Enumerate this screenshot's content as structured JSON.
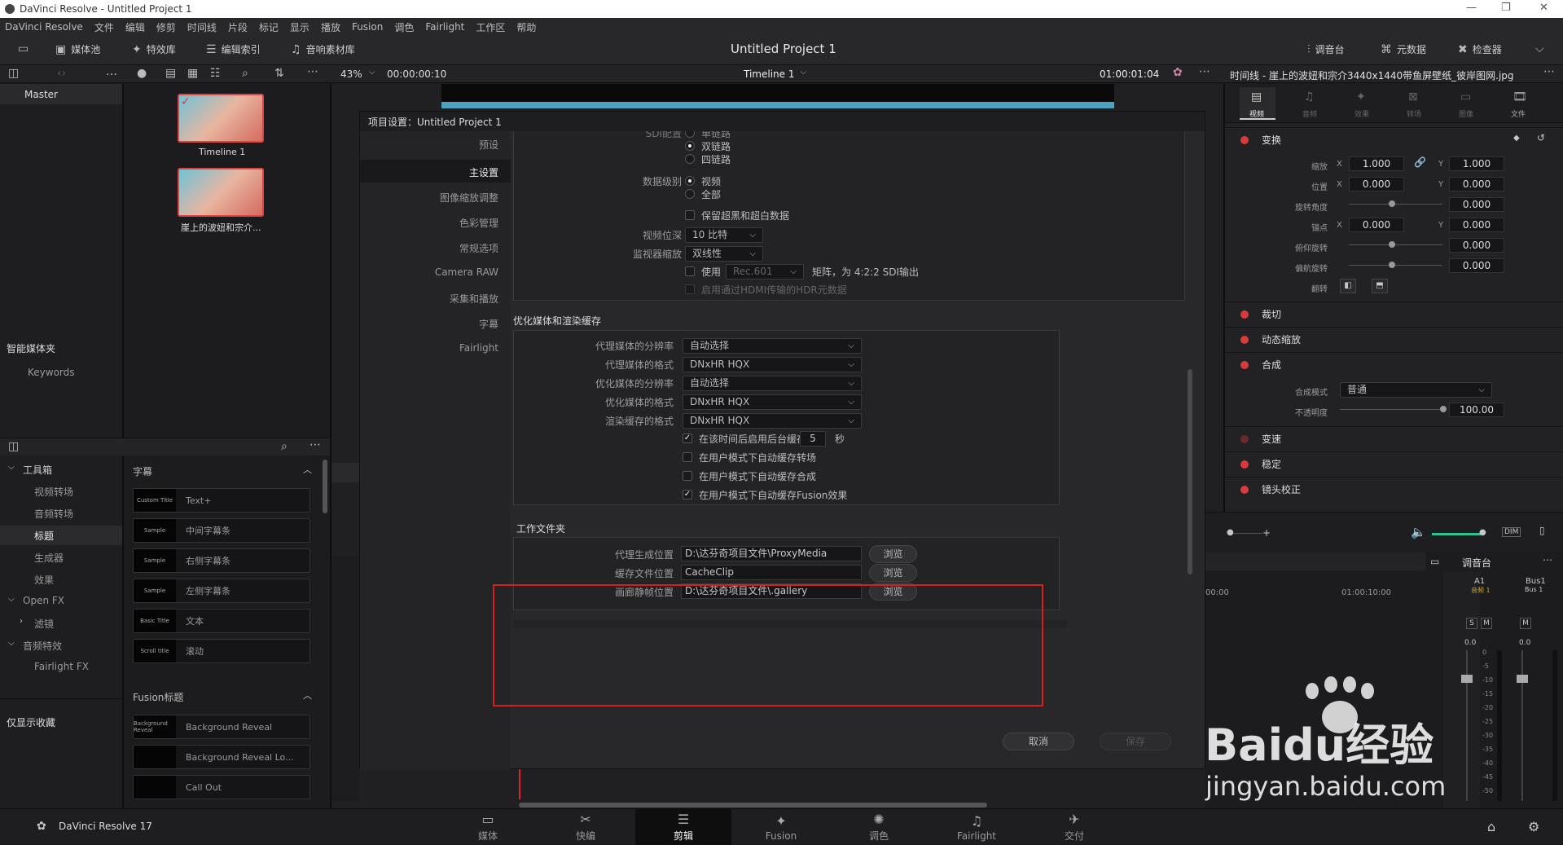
{
  "window": {
    "title": "DaVinci Resolve - Untitled Project 1"
  },
  "menu": [
    "DaVinci Resolve",
    "文件",
    "编辑",
    "修剪",
    "时间线",
    "片段",
    "标记",
    "显示",
    "播放",
    "Fusion",
    "调色",
    "Fairlight",
    "工作区",
    "帮助"
  ],
  "toolbar": {
    "media_pool": "媒体池",
    "effects": "特效库",
    "edit_index": "编辑索引",
    "sound_library": "音响素材库",
    "project_title": "Untitled Project 1",
    "mixer": "调音台",
    "metadata": "元数据",
    "inspector": "检查器"
  },
  "viewer": {
    "zoom": "43%",
    "timecode": "00:00:00:10",
    "timeline_name": "Timeline 1",
    "end_timecode": "01:00:01:04",
    "clip_title": "时间线 - 崖上的波妞和宗介3440x1440带鱼屏壁纸_彼岸图网.jpg"
  },
  "media": {
    "bin": "Master",
    "clips": [
      {
        "name": "Timeline 1"
      },
      {
        "name": "崖上的波妞和宗介..."
      }
    ],
    "smart_bins": "智能媒体夹",
    "keywords": "Keywords"
  },
  "toolbox": {
    "items": [
      "工具箱",
      "视频转场",
      "音频转场",
      "标题",
      "生成器",
      "效果",
      "Open FX",
      "滤镜",
      "音频特效",
      "Fairlight FX"
    ],
    "show_favs": "仅显示收藏",
    "titles_header": "字幕",
    "titles": [
      {
        "thumb": "Custom Title",
        "label": "Text+"
      },
      {
        "thumb": "Sample",
        "label": "中间字幕条"
      },
      {
        "thumb": "Sample",
        "label": "右侧字幕条"
      },
      {
        "thumb": "Sample",
        "label": "左侧字幕条"
      },
      {
        "thumb": "Basic Title",
        "label": "文本"
      },
      {
        "thumb": "Scroll title",
        "label": "滚动"
      }
    ],
    "fusion_header": "Fusion标题",
    "fusion_titles": [
      {
        "thumb": "Background Reveal",
        "label": "Background Reveal"
      },
      {
        "thumb": "",
        "label": "Background Reveal Lo..."
      },
      {
        "thumb": "",
        "label": "Call Out"
      }
    ]
  },
  "dialog": {
    "title": "项目设置：Untitled Project 1",
    "nav": [
      "预设",
      "主设置",
      "图像缩放调整",
      "色彩管理",
      "常规选项",
      "Camera RAW",
      "采集和播放",
      "字幕",
      "Fairlight"
    ],
    "active_nav": "主设置",
    "sdi_cut": "SDI配置",
    "sdi_options": [
      "单链路",
      "双链路",
      "四链路"
    ],
    "data_level_label": "数据级别",
    "data_level_options": [
      "视频",
      "全部"
    ],
    "retain_label": "保留超黑和超白数据",
    "video_bit_label": "视频位深",
    "video_bit_value": "10 比特",
    "monitor_scale_label": "监视器缩放",
    "monitor_scale_value": "双线性",
    "use_label": "使用",
    "matrix_value": "Rec.601",
    "matrix_tail": "矩阵，为 4:2:2 SDI输出",
    "hdmi_label": "启用通过HDMI传输的HDR元数据",
    "optimize_header": "优化媒体和渲染缓存",
    "opt_rows": [
      {
        "label": "代理媒体的分辨率",
        "value": "自动选择"
      },
      {
        "label": "代理媒体的格式",
        "value": "DNxHR HQX"
      },
      {
        "label": "优化媒体的分辨率",
        "value": "自动选择"
      },
      {
        "label": "优化媒体的格式",
        "value": "DNxHR HQX"
      },
      {
        "label": "渲染缓存的格式",
        "value": "DNxHR HQX"
      }
    ],
    "bg_cache_label": "在该时间后启用后台缓存",
    "bg_cache_seconds": "5",
    "bg_cache_unit": "秒",
    "checks": [
      "在用户模式下自动缓存转场",
      "在用户模式下自动缓存合成",
      "在用户模式下自动缓存Fusion效果"
    ],
    "working_header": "工作文件夹",
    "folders": [
      {
        "label": "代理生成位置",
        "value": "D:\\达芬奇项目文件\\ProxyMedia",
        "btn": "浏览"
      },
      {
        "label": "缓存文件位置",
        "value": "CacheClip",
        "btn": "浏览"
      },
      {
        "label": "画廊静帧位置",
        "value": "D:\\达芬奇项目文件\\.gallery",
        "btn": "浏览"
      }
    ],
    "cancel": "取消",
    "save": "保存"
  },
  "inspector": {
    "tabs": [
      "视频",
      "音频",
      "效果",
      "转场",
      "图像",
      "文件"
    ],
    "transform": "变换",
    "zoom_label": "缩放",
    "zoom_x": "1.000",
    "zoom_y": "1.000",
    "pos_label": "位置",
    "pos_x": "0.000",
    "pos_y": "0.000",
    "rot_label": "旋转角度",
    "rot": "0.000",
    "anchor_label": "锚点",
    "anchor_x": "0.000",
    "anchor_y": "0.000",
    "pitch_label": "俯仰旋转",
    "pitch": "0.000",
    "yaw_label": "偏航旋转",
    "yaw": "0.000",
    "flip_label": "翻转",
    "x": "X",
    "y": "Y",
    "sections": [
      "裁切",
      "动态缩放",
      "合成"
    ],
    "comp_mode_label": "合成模式",
    "comp_mode": "普通",
    "opacity_label": "不透明度",
    "opacity": "100.00",
    "sections2": [
      "变速",
      "稳定",
      "镜头校正"
    ]
  },
  "mixer": {
    "title": "调音台",
    "a1": "A1",
    "a1_sub": "音频 1",
    "bus": "Bus1",
    "bus_sub": "Bus 1",
    "s": "S",
    "m": "M",
    "db0": "0.0",
    "ticks": [
      "0",
      "-5",
      "-10",
      "-15",
      "-20",
      "-25",
      "-30",
      "-35",
      "-40",
      "-45",
      "-50"
    ],
    "ruler": [
      "00:00",
      "01:00:10:00"
    ]
  },
  "watermark": {
    "logo": "Baidu经验",
    "url": "jingyan.baidu.com"
  },
  "pages": [
    "媒体",
    "快编",
    "剪辑",
    "Fusion",
    "调色",
    "Fairlight",
    "交付"
  ],
  "active_page": "剪辑",
  "brand": "DaVinci Resolve 17"
}
